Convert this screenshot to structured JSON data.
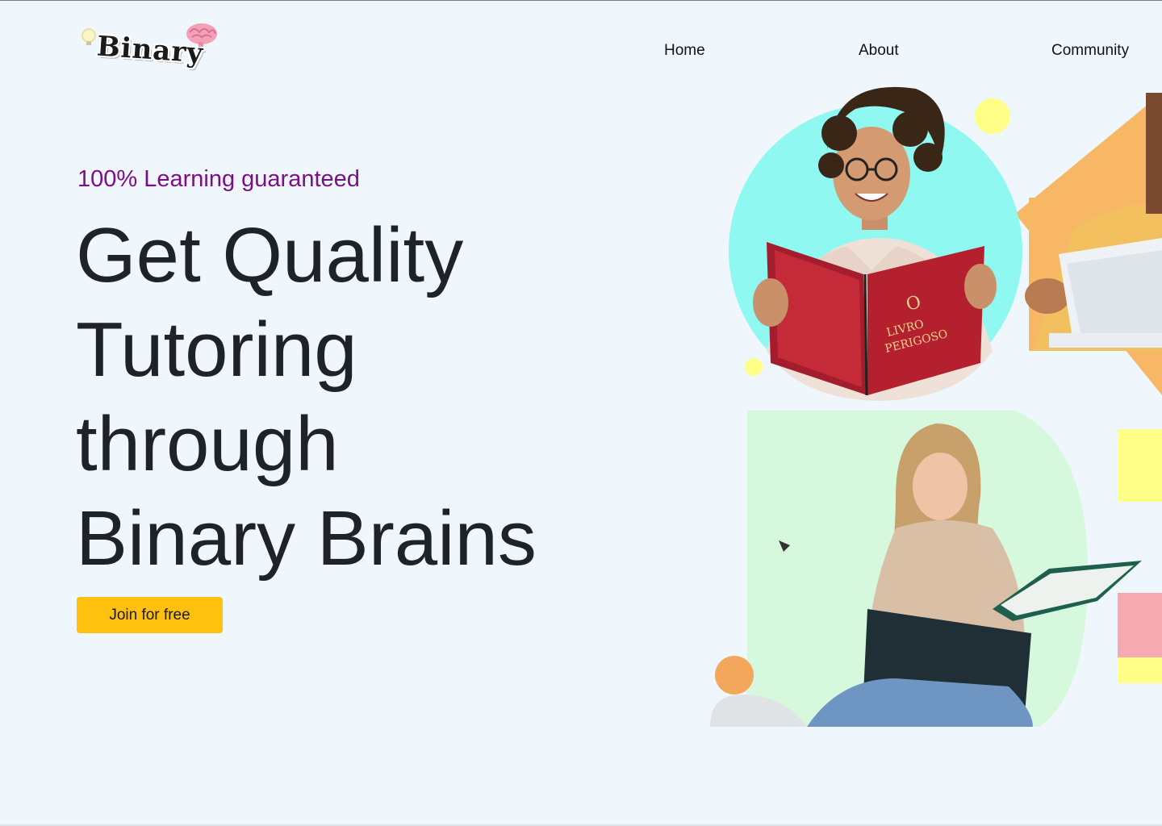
{
  "header": {
    "logo_text": "Binary",
    "logo_icons": [
      "lightbulb-icon",
      "brain-icon"
    ],
    "nav": [
      {
        "label": "Home"
      },
      {
        "label": "About"
      },
      {
        "label": "Community"
      }
    ]
  },
  "hero": {
    "tagline": "100% Learning guaranteed",
    "headline_lines": [
      "Get Quality",
      "Tutoring",
      "through",
      "Binary Brains"
    ],
    "cta_label": "Join for free"
  },
  "colors": {
    "background": "#eff7fd",
    "tagline": "#7d0f86",
    "cta": "#ffc10d",
    "circle_bg": "#8ff8f0",
    "orange_shape": "#f7b765",
    "green_panel": "#d6f8dc",
    "yellow_accent": "#ffff88"
  },
  "images": [
    {
      "name": "student-reading-book-photo",
      "description_icon": "person-reading-red-book"
    },
    {
      "name": "student-with-papers-photo",
      "description_icon": "person-holding-papers"
    },
    {
      "name": "student-with-laptop-photo",
      "description_icon": "person-with-laptop-and-book"
    }
  ]
}
